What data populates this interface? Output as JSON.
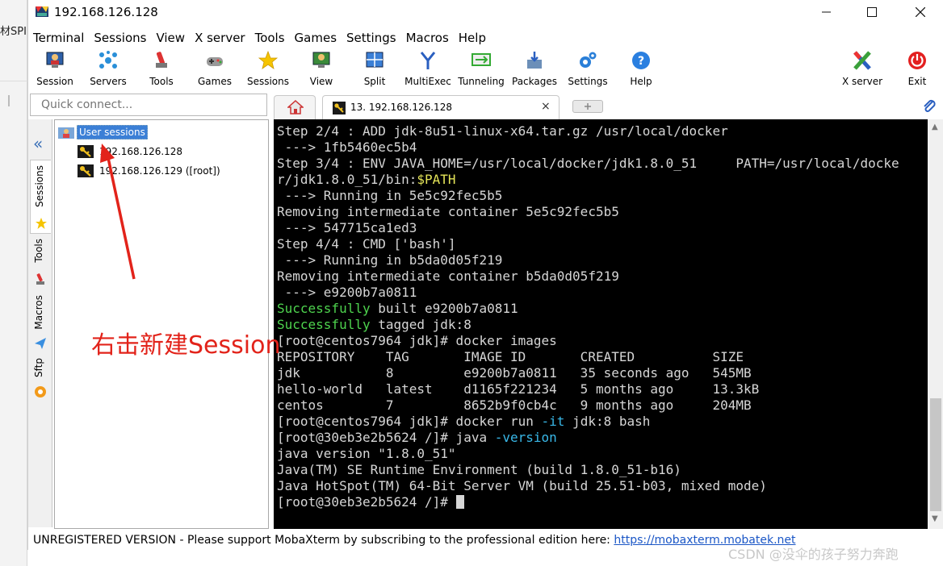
{
  "background": {
    "fragment": "材SPI"
  },
  "window": {
    "title": "192.168.126.128"
  },
  "menu": [
    "Terminal",
    "Sessions",
    "View",
    "X server",
    "Tools",
    "Games",
    "Settings",
    "Macros",
    "Help"
  ],
  "toolbar": {
    "session": "Session",
    "servers": "Servers",
    "tools": "Tools",
    "games": "Games",
    "sessions": "Sessions",
    "view": "View",
    "split": "Split",
    "multiexec": "MultiExec",
    "tunneling": "Tunneling",
    "packages": "Packages",
    "settings": "Settings",
    "help": "Help",
    "xserver": "X server",
    "exit": "Exit"
  },
  "quick_connect": {
    "placeholder": "Quick connect..."
  },
  "tabs": {
    "active": "13. 192.168.126.128",
    "close": "×"
  },
  "side_tabs": {
    "sessions": "Sessions",
    "tools": "Tools",
    "macros": "Macros",
    "sftp": "Sftp"
  },
  "tree": {
    "root": "User sessions",
    "items": [
      "192.168.126.128",
      "192.168.126.129 ([root])"
    ]
  },
  "terminal": {
    "l01": "Step 2/4 : ADD jdk-8u51-linux-x64.tar.gz /usr/local/docker",
    "l02": " ---> 1fb5460ec5b4",
    "l03": "Step 3/4 : ENV JAVA_HOME=/usr/local/docker/jdk1.8.0_51     PATH=/usr/local/docke",
    "l04a": "r/jdk1.8.0_51/bin:",
    "l04b": "$PATH",
    "l05": " ---> Running in 5e5c92fec5b5",
    "l06": "Removing intermediate container 5e5c92fec5b5",
    "l07": " ---> 547715ca1ed3",
    "l08": "Step 4/4 : CMD ['bash']",
    "l09": " ---> Running in b5da0d05f219",
    "l10": "Removing intermediate container b5da0d05f219",
    "l11": " ---> e9200b7a0811",
    "l12a": "Successfully",
    "l12b": " built e9200b7a0811",
    "l13a": "Successfully",
    "l13b": " tagged jdk:8",
    "l14": "[root@centos7964 jdk]# docker images",
    "l15": "REPOSITORY    TAG       IMAGE ID       CREATED          SIZE",
    "l16": "jdk           8         e9200b7a0811   35 seconds ago   545MB",
    "l17": "hello-world   latest    d1165f221234   5 months ago     13.3kB",
    "l18": "centos        7         8652b9f0cb4c   9 months ago     204MB",
    "l19a": "[root@centos7964 jdk]# docker run ",
    "l19b": "-it",
    "l19c": " jdk:8 bash",
    "l20a": "[root@30eb3e2b5624 /]# java ",
    "l20b": "-version",
    "l21": "java version \"1.8.0_51\"",
    "l22": "Java(TM) SE Runtime Environment (build 1.8.0_51-b16)",
    "l23": "Java HotSpot(TM) 64-Bit Server VM (build 25.51-b03, mixed mode)",
    "l24": "[root@30eb3e2b5624 /]# "
  },
  "status": {
    "unregistered": "UNREGISTERED VERSION",
    "message": "  -  Please support MobaXterm by subscribing to the professional edition here:  ",
    "link": "https://mobaxterm.mobatek.net"
  },
  "annotation": {
    "text": "右击新建Session",
    "color": "#e2231a"
  },
  "watermark": "CSDN @没伞的孩子努力奔跑"
}
